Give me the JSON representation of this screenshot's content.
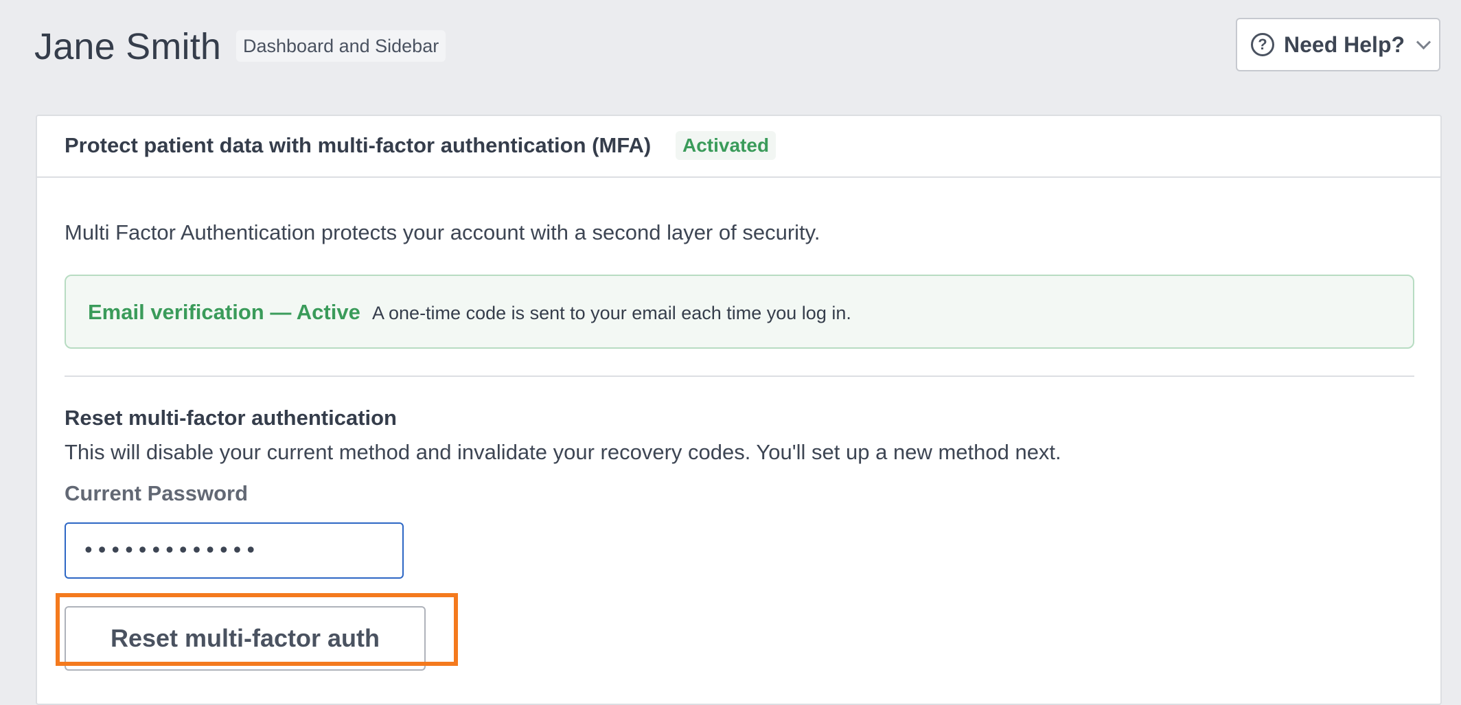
{
  "header": {
    "user_name": "Jane Smith",
    "context_badge": "Dashboard and Sidebar",
    "help_button_label": "Need Help?",
    "help_icon": "question-circle-icon",
    "help_chevron_icon": "chevron-down-icon"
  },
  "card": {
    "title": "Protect patient data with multi-factor authentication (MFA)",
    "status_badge": "Activated",
    "intro": "Multi Factor Authentication protects your account with a second layer of security.",
    "method": {
      "title": "Email verification — Active",
      "description": "A one-time code is sent to your email each time you log in."
    },
    "reset": {
      "heading": "Reset multi-factor authentication",
      "description": "This will disable your current method and invalidate your recovery codes. You'll set up a new method next.",
      "password_label": "Current Password",
      "password_value": "•••••••••••••",
      "button_label": "Reset multi-factor auth"
    }
  },
  "colors": {
    "page_background": "#ebecef",
    "active_green": "#3a9b5a",
    "input_focus_blue": "#2c66c4",
    "highlight_orange": "#f47a1e"
  }
}
